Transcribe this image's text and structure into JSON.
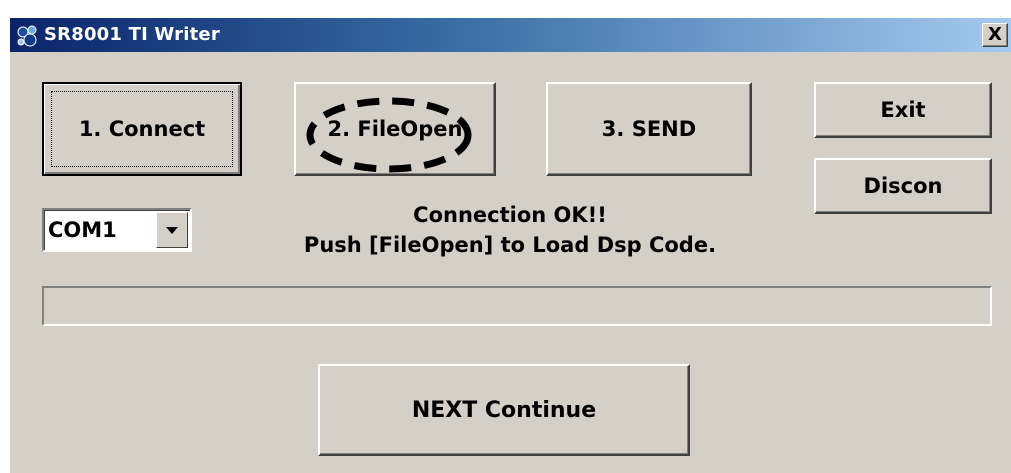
{
  "window": {
    "title": "SR8001 TI Writer",
    "close_label": "X"
  },
  "buttons": {
    "connect": "1. Connect",
    "file_open": "2. FileOpen",
    "send": "3. SEND",
    "exit": "Exit",
    "discon": "Discon",
    "next_continue": "NEXT Continue"
  },
  "port_select": {
    "selected": "COM1"
  },
  "status": {
    "line1": "Connection OK!!",
    "line2": "Push [FileOpen] to Load Dsp Code."
  },
  "progress": {
    "value": 0
  },
  "icons": {
    "app": "writer-app-icon",
    "dropdown": "chevron-down-icon"
  },
  "colors": {
    "titlebar_start": "#0a246a",
    "titlebar_end": "#a6caf0",
    "face": "#d4d0c8",
    "annotation": "#000000"
  }
}
